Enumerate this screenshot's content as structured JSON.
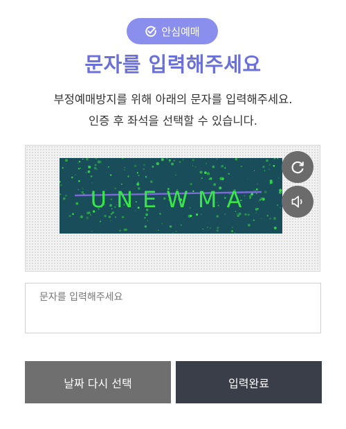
{
  "badge": {
    "label": "안심예매"
  },
  "title": "문자를 입력해주세요",
  "description": {
    "line1": "부정예매방지를 위해 아래의 문자를 입력해주세요.",
    "line2": "인증 후 좌석을 선택할 수 있습니다."
  },
  "captcha": {
    "text": "UNEWMA",
    "text_color": "#39e54a",
    "bg_color": "#1a4d5a"
  },
  "input": {
    "placeholder": "문자를 입력해주세요",
    "value": ""
  },
  "buttons": {
    "back_label": "날짜 다시 선택",
    "submit_label": "입력완료"
  },
  "icons": {
    "badge": "check-circle-icon",
    "refresh": "refresh-icon",
    "audio": "speaker-icon"
  },
  "colors": {
    "accent": "#6a70d8",
    "badge": "#8a8fee",
    "submit": "#3a3e48",
    "back": "#6f6f6f"
  }
}
